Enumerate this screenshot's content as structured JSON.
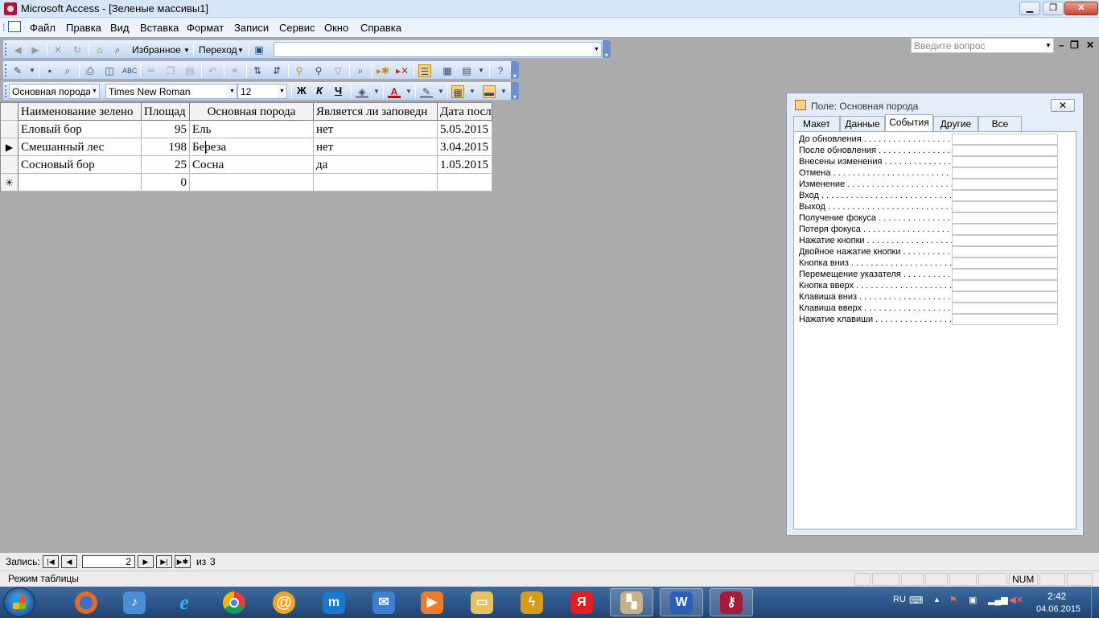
{
  "app": {
    "title": "Microsoft Access - [Зеленые массивы1]"
  },
  "menu": {
    "items": [
      "Файл",
      "Правка",
      "Вид",
      "Вставка",
      "Формат",
      "Записи",
      "Сервис",
      "Окно",
      "Справка"
    ],
    "help_placeholder": "Введите вопрос"
  },
  "web_toolbar": {
    "favorites": "Избранное",
    "go": "Переход",
    "address": ""
  },
  "format_toolbar": {
    "object": "Основная порода",
    "font": "Times New Roman",
    "size": "12",
    "bold": "Ж",
    "italic": "К",
    "underline": "Ч"
  },
  "datasheet": {
    "columns": [
      "Наименование зелено",
      "Площад",
      "Основная порода",
      "Является ли заповедн",
      "Дата посл"
    ],
    "rows": [
      {
        "name": "Еловый бор",
        "area": "95",
        "species": "Ель",
        "reserve": "нет",
        "date": "5.05.2015"
      },
      {
        "name": "Смешанный лес",
        "area": "198",
        "species": "Береза",
        "reserve": "нет",
        "date": "3.04.2015"
      },
      {
        "name": "Сосновый бор",
        "area": "25",
        "species": "Сосна",
        "reserve": "да",
        "date": "1.05.2015"
      }
    ],
    "new_row": {
      "area": "0"
    }
  },
  "properties": {
    "title": "Поле: Основная порода",
    "tabs": [
      "Макет",
      "Данные",
      "События",
      "Другие",
      "Все"
    ],
    "active_tab": "События",
    "events": [
      "До обновления",
      "После обновления",
      "Внесены изменения",
      "Отмена",
      "Изменение",
      "Вход",
      "Выход",
      "Получение фокуса",
      "Потеря фокуса",
      "Нажатие кнопки",
      "Двойное нажатие кнопки",
      "Кнопка вниз",
      "Перемещение указателя",
      "Кнопка вверх",
      "Клавиша вниз",
      "Клавиша вверх",
      "Нажатие клавиши"
    ]
  },
  "nav": {
    "label": "Запись:",
    "current": "2",
    "of": "из",
    "total": "3"
  },
  "status": {
    "text": "Режим таблицы",
    "num": "NUM"
  },
  "taskbar": {
    "lang": "RU",
    "time": "2:42",
    "date": "04.06.2015"
  },
  "colors": {
    "accent": "#d6e6fa",
    "workspace": "#ababab",
    "taskbar": "#1f4471"
  }
}
